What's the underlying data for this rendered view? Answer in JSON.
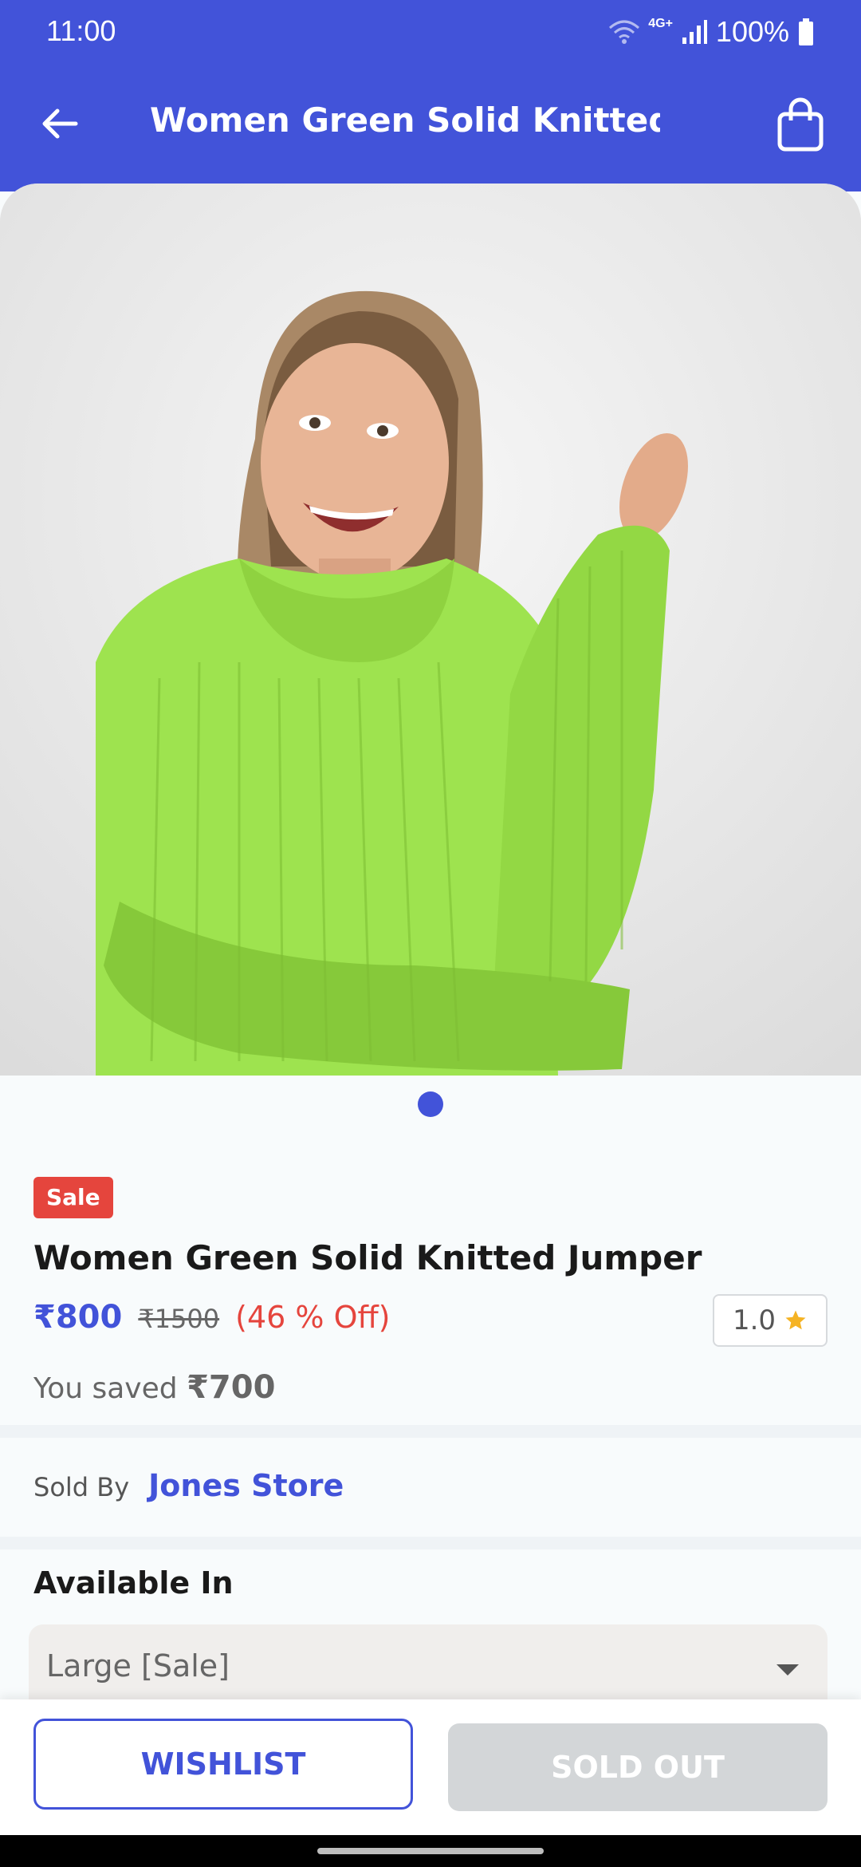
{
  "status_bar": {
    "time": "11:00",
    "network": "4G+",
    "battery": "100%"
  },
  "app_bar": {
    "title": "Women Green Solid Knitted ..."
  },
  "product": {
    "badge": "Sale",
    "name": "Women Green Solid Knitted Jumper",
    "price": "₹800",
    "mrp": "₹1500",
    "discount": "(46 % Off)",
    "rating": "1.0",
    "saved_label": "You saved",
    "saved_amount": "₹700",
    "image_count": 1,
    "active_image_index": 0
  },
  "seller": {
    "label": "Sold By",
    "name": "Jones Store"
  },
  "availability": {
    "title": "Available In",
    "selected": "Large [Sale]"
  },
  "actions": {
    "wishlist": "WISHLIST",
    "sold_out": "SOLD OUT"
  },
  "colors": {
    "brand": "#4253d9",
    "sale": "#e5453d",
    "disabled": "#d3d6d8",
    "star": "#f5b324"
  },
  "icons": [
    "back-arrow-icon",
    "shopping-bag-icon",
    "wifi-icon",
    "signal-icon",
    "battery-icon",
    "star-icon",
    "dropdown-caret-icon"
  ]
}
